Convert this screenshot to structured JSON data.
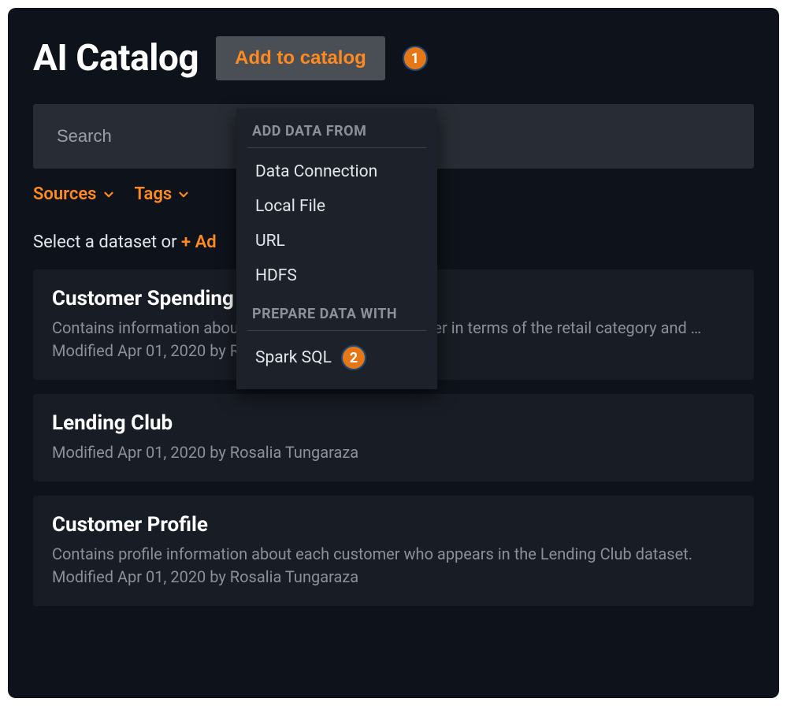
{
  "header": {
    "title": "AI Catalog",
    "add_button_label": "Add to catalog",
    "badge1": "1"
  },
  "search": {
    "placeholder": "Search",
    "value": ""
  },
  "filters": {
    "sources_label": "Sources",
    "tags_label": "Tags"
  },
  "prompt": {
    "prefix": "Select a dataset or ",
    "link_visible": "+ Ad"
  },
  "dropdown": {
    "section1_label": "ADD DATA FROM",
    "section2_label": "PREPARE DATA WITH",
    "items1": [
      "Data Connection",
      "Local File",
      "URL",
      "HDFS"
    ],
    "spark_label": "Spark SQL",
    "badge2": "2"
  },
  "datasets": [
    {
      "title": "Customer Spending",
      "desc": "Contains information about each Lending Club customer in terms of the retail category and …",
      "meta": "Modified Apr 01, 2020 by Rosalia Tungaraza"
    },
    {
      "title": "Lending Club",
      "desc": "",
      "meta": "Modified Apr 01, 2020 by Rosalia Tungaraza"
    },
    {
      "title": "Customer Profile",
      "desc": "Contains profile information about each customer who appears in the Lending Club dataset.",
      "meta": "Modified Apr 01, 2020 by Rosalia Tungaraza"
    }
  ]
}
